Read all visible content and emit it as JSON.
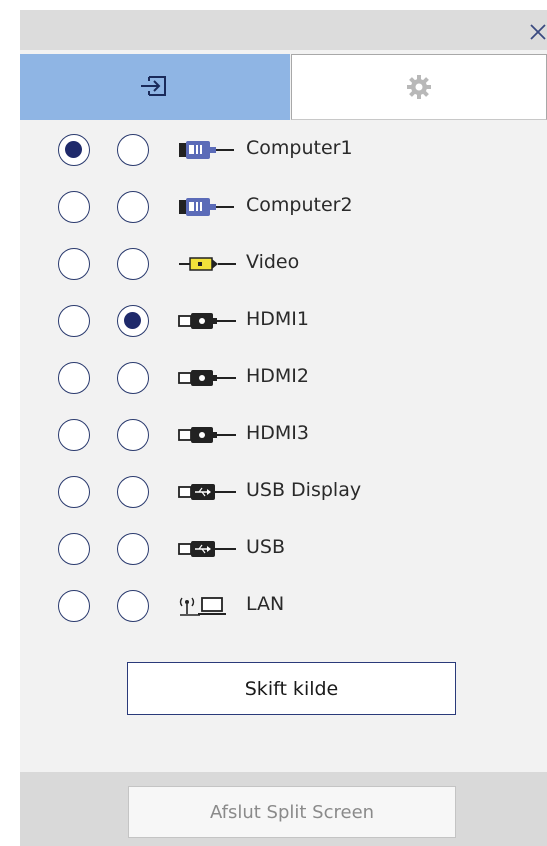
{
  "window": {
    "close_icon": "close-icon"
  },
  "tabs": [
    {
      "id": "input",
      "icon": "input-source-icon",
      "active": true,
      "color": "#8fb5e4"
    },
    {
      "id": "settings",
      "icon": "gear-icon",
      "active": false
    }
  ],
  "sources": [
    {
      "label": "Computer1",
      "icon": "vga-connector-icon",
      "left_selected": true,
      "right_selected": false
    },
    {
      "label": "Computer2",
      "icon": "vga-connector-icon",
      "left_selected": false,
      "right_selected": false
    },
    {
      "label": "Video",
      "icon": "rca-video-icon",
      "left_selected": false,
      "right_selected": false
    },
    {
      "label": "HDMI1",
      "icon": "hdmi-connector-icon",
      "left_selected": false,
      "right_selected": true
    },
    {
      "label": "HDMI2",
      "icon": "hdmi-connector-icon",
      "left_selected": false,
      "right_selected": false
    },
    {
      "label": "HDMI3",
      "icon": "hdmi-connector-icon",
      "left_selected": false,
      "right_selected": false
    },
    {
      "label": "USB Display",
      "icon": "usb-connector-icon",
      "left_selected": false,
      "right_selected": false
    },
    {
      "label": "USB",
      "icon": "usb-connector-icon",
      "left_selected": false,
      "right_selected": false
    },
    {
      "label": "LAN",
      "icon": "lan-computer-icon",
      "left_selected": false,
      "right_selected": false
    }
  ],
  "actions": {
    "switch_source_label": "Skift kilde",
    "exit_split_label": "Afslut Split Screen"
  },
  "colors": {
    "selected_dot": "#1f2a6b",
    "accent_tab": "#8fb5e4",
    "panel_bg": "#f2f2f2"
  }
}
